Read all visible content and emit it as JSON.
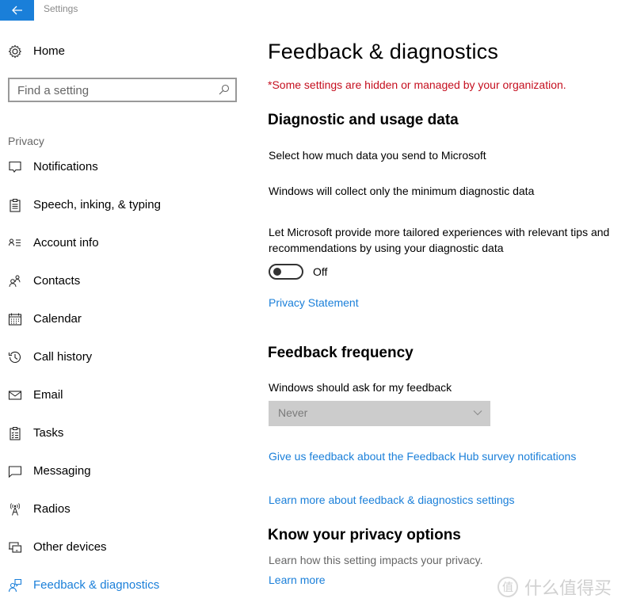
{
  "window": {
    "title": "Settings",
    "back_icon": "arrow-left-icon",
    "accent_color": "#1a7fd9"
  },
  "sidebar": {
    "home": {
      "label": "Home",
      "icon": "gear-icon"
    },
    "search": {
      "placeholder": "Find a setting",
      "value": "",
      "icon": "search-icon"
    },
    "section_label": "Privacy",
    "items": [
      {
        "label": "Notifications",
        "icon": "notification-icon",
        "active": false
      },
      {
        "label": "Speech, inking, & typing",
        "icon": "clipboard-icon",
        "active": false
      },
      {
        "label": "Account info",
        "icon": "account-info-icon",
        "active": false
      },
      {
        "label": "Contacts",
        "icon": "contacts-icon",
        "active": false
      },
      {
        "label": "Calendar",
        "icon": "calendar-icon",
        "active": false
      },
      {
        "label": "Call history",
        "icon": "history-icon",
        "active": false
      },
      {
        "label": "Email",
        "icon": "email-icon",
        "active": false
      },
      {
        "label": "Tasks",
        "icon": "tasks-icon",
        "active": false
      },
      {
        "label": "Messaging",
        "icon": "message-icon",
        "active": false
      },
      {
        "label": "Radios",
        "icon": "radio-tower-icon",
        "active": false
      },
      {
        "label": "Other devices",
        "icon": "devices-icon",
        "active": false
      },
      {
        "label": "Feedback & diagnostics",
        "icon": "feedback-icon",
        "active": true
      }
    ]
  },
  "main": {
    "title": "Feedback & diagnostics",
    "org_warning": "*Some settings are hidden or managed by your organization.",
    "warning_color": "#c50f1f",
    "diagnostic": {
      "heading": "Diagnostic and usage data",
      "select_text": "Select how much data you send to Microsoft",
      "level_text": "Windows will collect only the minimum diagnostic data",
      "tailored_text": "Let Microsoft provide more tailored experiences with relevant tips and recommendations by using your diagnostic data",
      "toggle_state": "Off",
      "toggle_on": false,
      "privacy_link": "Privacy Statement"
    },
    "feedback": {
      "heading": "Feedback frequency",
      "ask_label": "Windows should ask for my feedback",
      "dropdown_value": "Never",
      "survey_link": "Give us feedback about the Feedback Hub survey notifications",
      "learn_more_link": "Learn more about feedback & diagnostics settings"
    },
    "privacy_options": {
      "heading": "Know your privacy options",
      "description": "Learn how this setting impacts your privacy.",
      "link": "Learn more"
    }
  },
  "watermark": {
    "badge": "值",
    "text": "什么值得买"
  }
}
